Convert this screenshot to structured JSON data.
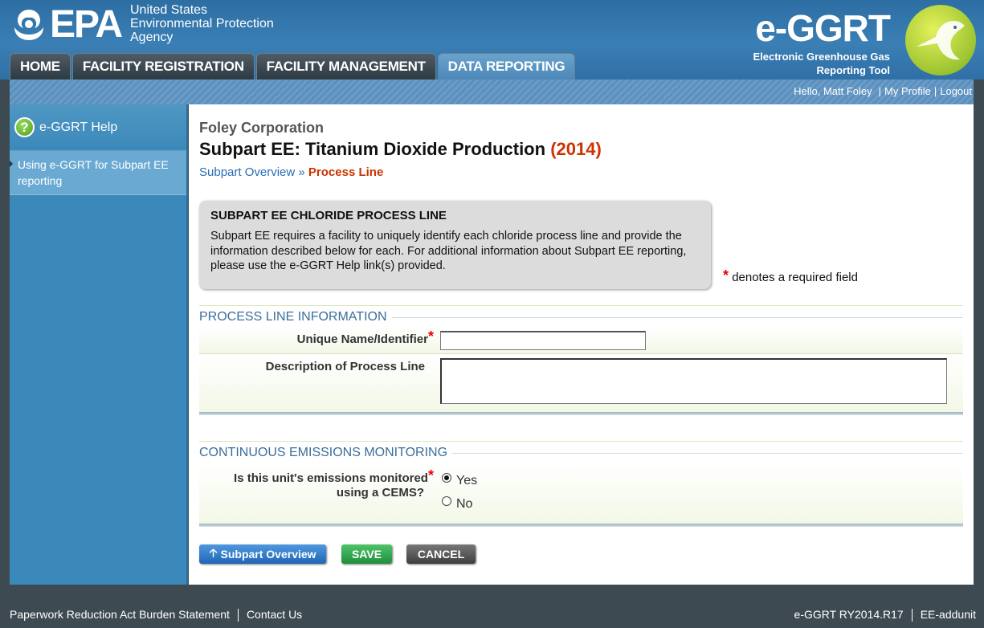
{
  "header": {
    "epa_text": "EPA",
    "agency_lines": [
      "United States",
      "Environmental Protection",
      "Agency"
    ],
    "eggrt_title": "e-GGRT",
    "eggrt_sub_lines": [
      "Electronic Greenhouse Gas",
      "Reporting Tool"
    ]
  },
  "tabs": [
    {
      "label": "HOME",
      "active": false
    },
    {
      "label": "FACILITY REGISTRATION",
      "active": false
    },
    {
      "label": "FACILITY MANAGEMENT",
      "active": false
    },
    {
      "label": "DATA REPORTING",
      "active": true
    }
  ],
  "userbar": {
    "greeting": "Hello, Matt Foley",
    "profile": "My Profile",
    "logout": "Logout",
    "separator": "|"
  },
  "sidebar": {
    "help_icon_glyph": "?",
    "help_title": "e-GGRT Help",
    "help_link": "Using e-GGRT for Subpart EE reporting"
  },
  "main": {
    "company": "Foley Corporation",
    "title": "Subpart EE: Titanium Dioxide Production",
    "year": "(2014)",
    "breadcrumb": {
      "parent": "Subpart Overview",
      "sep": "»",
      "current": "Process Line"
    },
    "infobox": {
      "heading": "SUBPART EE CHLORIDE PROCESS LINE",
      "text": "Subpart EE requires a facility to uniquely identify each chloride process line and provide the information described below for each. For additional information about Subpart EE reporting, please use the e-GGRT Help link(s) provided."
    },
    "required_note": "denotes a required field",
    "required_mark": "*",
    "section1": {
      "heading": "PROCESS LINE INFORMATION",
      "unique_label": "Unique Name/Identifier",
      "unique_value": "",
      "desc_label": "Description of Process Line",
      "desc_value": ""
    },
    "section2": {
      "heading": "CONTINUOUS EMISSIONS MONITORING",
      "question_line1": "Is this unit's emissions monitored",
      "question_line2": "using a CEMS?",
      "options": [
        "Yes",
        "No"
      ],
      "selected": "Yes"
    },
    "buttons": {
      "overview": "Subpart Overview",
      "save": "SAVE",
      "cancel": "CANCEL"
    }
  },
  "footer": {
    "paperwork": "Paperwork Reduction Act Burden Statement",
    "contact": "Contact Us",
    "version": "e-GGRT RY2014.R17",
    "env": "EE-addunit"
  },
  "colors": {
    "header_blue": "#3a7fb5",
    "active_tab": "#4c87b8",
    "sidebar_blue": "#3b89ba",
    "year_red": "#cc3300",
    "link_blue": "#2a6db5",
    "save_green": "#1f8f3c"
  }
}
